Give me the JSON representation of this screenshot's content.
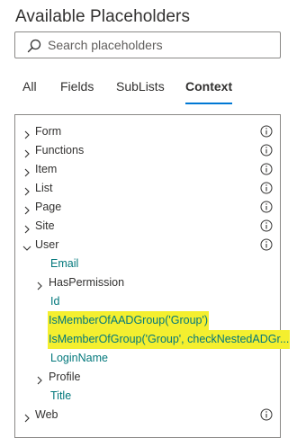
{
  "header": {
    "title": "Available Placeholders"
  },
  "search": {
    "placeholder": "Search placeholders",
    "value": ""
  },
  "tabs": [
    {
      "label": "All"
    },
    {
      "label": "Fields"
    },
    {
      "label": "SubLists"
    },
    {
      "label": "Context",
      "active": true
    }
  ],
  "tree": {
    "form": "Form",
    "functions": "Functions",
    "item": "Item",
    "list": "List",
    "page": "Page",
    "site": "Site",
    "user": "User",
    "user_children": {
      "email": "Email",
      "has_permission": "HasPermission",
      "id": "Id",
      "is_member_of_aad_group": "IsMemberOfAADGroup('Group')",
      "is_member_of_group": "IsMemberOfGroup('Group', checkNestedADGr...",
      "login_name": "LoginName",
      "profile": "Profile",
      "title": "Title"
    },
    "web": "Web"
  },
  "colors": {
    "accent": "#0078d4",
    "leaf_text": "#03787c",
    "highlight": "#f4ef2f",
    "border": "#8a8886"
  },
  "icons": [
    "search-icon",
    "chevron-right-icon",
    "chevron-down-icon",
    "info-icon"
  ]
}
